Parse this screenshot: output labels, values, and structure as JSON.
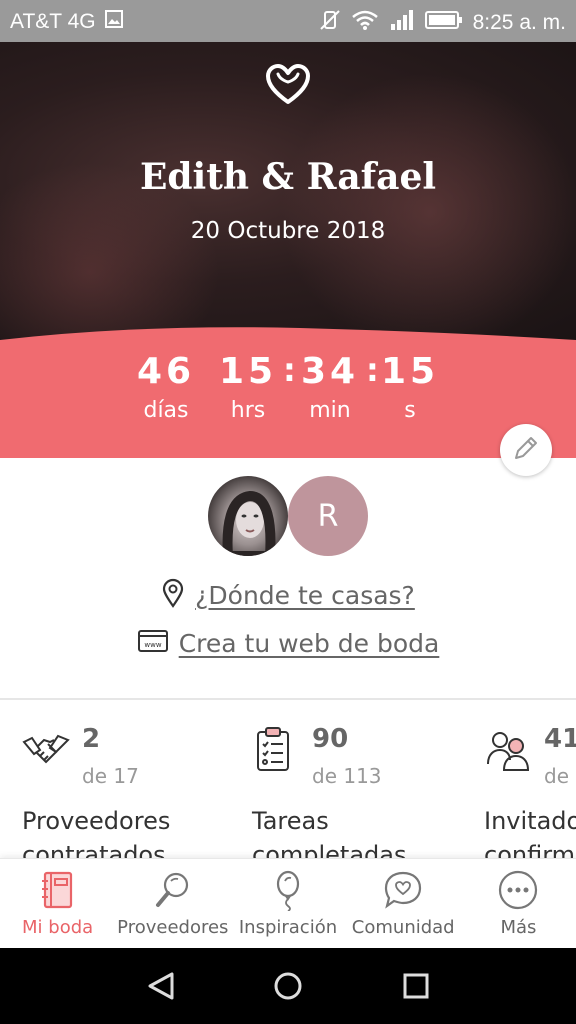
{
  "status_bar": {
    "carrier": "AT&T 4G",
    "time": "8:25 a. m.",
    "icons": [
      "image-icon",
      "vibrate-icon",
      "wifi-icon",
      "signal-icon",
      "battery-icon"
    ]
  },
  "hero": {
    "icon": "heart-outline-icon",
    "couple": "Edith & Rafael",
    "date": "20 Octubre 2018"
  },
  "countdown": {
    "days": "46",
    "days_label": "días",
    "hours": "15",
    "hours_label": "hrs",
    "minutes": "34",
    "minutes_label": "min",
    "seconds": "15",
    "seconds_label": "s",
    "color": "#f06b70"
  },
  "avatars": {
    "second_initial": "R"
  },
  "links": {
    "location": "¿Dónde te casas?",
    "website": "Crea tu web de boda"
  },
  "stats": [
    {
      "icon": "handshake-icon",
      "count": "2",
      "total": "de 17",
      "label_line1": "Proveedores",
      "label_line2": "contratados"
    },
    {
      "icon": "checklist-icon",
      "count": "90",
      "total": "de 113",
      "label_line1": "Tareas",
      "label_line2": "completadas"
    },
    {
      "icon": "guests-icon",
      "count": "41",
      "total": "de",
      "label_line1": "Invitados",
      "label_line2": "confirm"
    }
  ],
  "bottom_nav": [
    {
      "label": "Mi boda",
      "icon": "notebook-icon",
      "active": true
    },
    {
      "label": "Proveedores",
      "icon": "magnifier-icon",
      "active": false
    },
    {
      "label": "Inspiración",
      "icon": "balloon-icon",
      "active": false
    },
    {
      "label": "Comunidad",
      "icon": "chat-heart-icon",
      "active": false
    },
    {
      "label": "Más",
      "icon": "more-icon",
      "active": false
    }
  ],
  "colors": {
    "accent": "#e96468",
    "band": "#f06b70",
    "avatar_r": "#bf959c"
  }
}
